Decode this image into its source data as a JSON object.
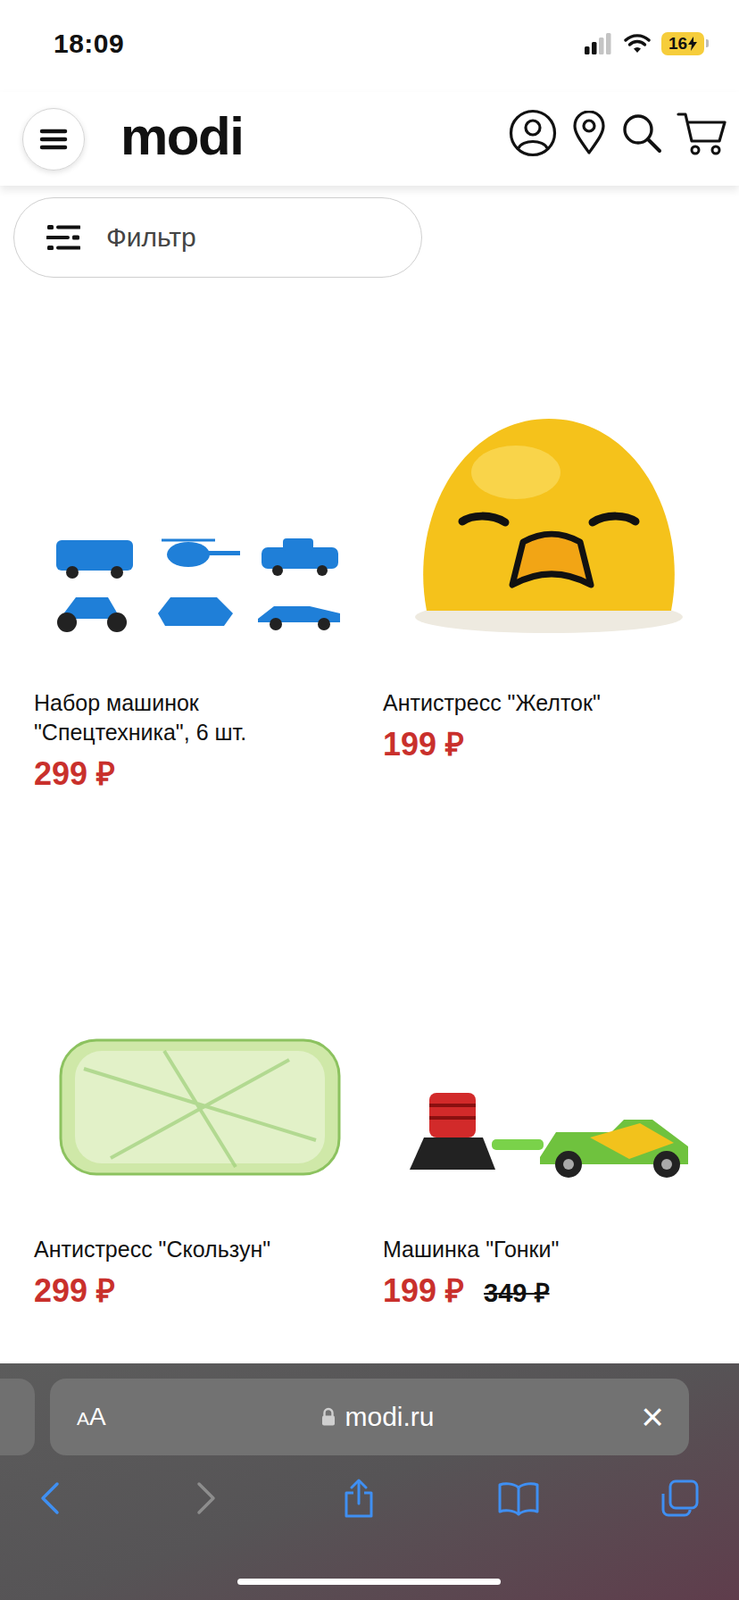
{
  "status_bar": {
    "time": "18:09",
    "signal": {
      "level": 0.5
    },
    "battery": {
      "text": "16",
      "charging": true
    }
  },
  "header": {
    "logo": "modi"
  },
  "filter": {
    "label": "Фильтр"
  },
  "products": [
    {
      "name": "Набор машинок \"Спецтехника\", 6 шт.",
      "price": "299 ₽"
    },
    {
      "name": "Антистресс \"Желток\"",
      "price": "199 ₽"
    },
    {
      "name": "Антистресс \"Скользун\"",
      "price": "299 ₽"
    },
    {
      "name": "Машинка \"Гонки\"",
      "price": "199 ₽",
      "old_price": "349 ₽"
    }
  ],
  "browser": {
    "text_size": "AA",
    "url": "modi.ru",
    "close": "×",
    "back": {
      "disabled": false
    },
    "forward": {
      "disabled": true
    }
  }
}
